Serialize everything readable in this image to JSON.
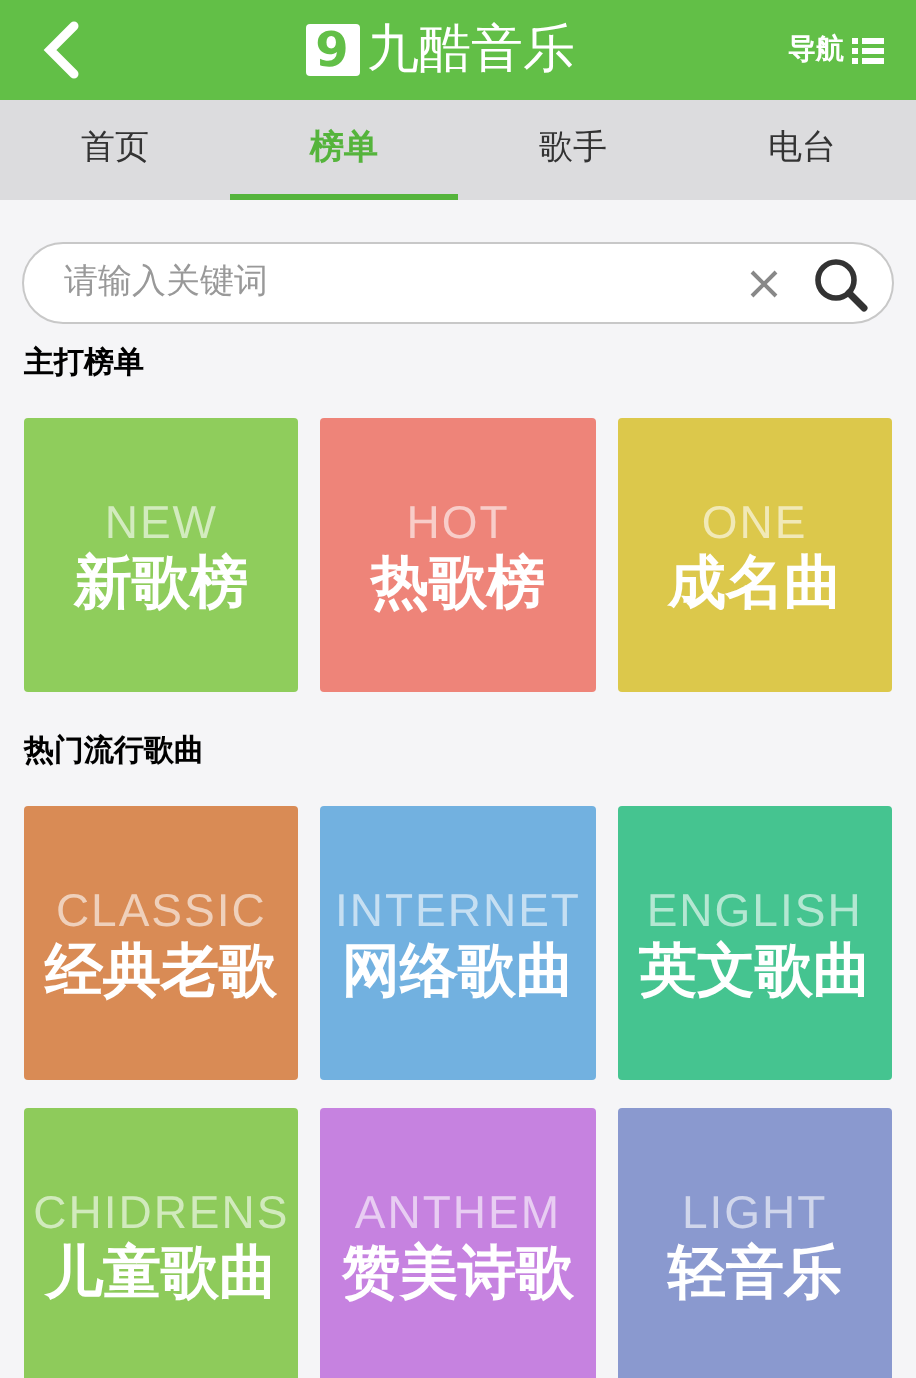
{
  "header": {
    "logo_mark": "9",
    "title": "九酷音乐",
    "nav_label": "导航"
  },
  "tabs": [
    {
      "label": "首页",
      "selected": false
    },
    {
      "label": "榜单",
      "selected": true
    },
    {
      "label": "歌手",
      "selected": false
    },
    {
      "label": "电台",
      "selected": false
    }
  ],
  "search": {
    "placeholder": "请输入关键词"
  },
  "sections": [
    {
      "title": "主打榜单",
      "tiles": [
        {
          "english": "NEW",
          "label": "新歌榜",
          "color": "#8fcd5c"
        },
        {
          "english": "HOT",
          "label": "热歌榜",
          "color": "#ee8479"
        },
        {
          "english": "ONE",
          "label": "成名曲",
          "color": "#dcc84b"
        }
      ]
    },
    {
      "title": "热门流行歌曲",
      "tiles": [
        {
          "english": "CLASSIC",
          "label": "经典老歌",
          "color": "#d98b55"
        },
        {
          "english": "INTERNET",
          "label": "网络歌曲",
          "color": "#72b1e0"
        },
        {
          "english": "ENGLISH",
          "label": "英文歌曲",
          "color": "#45c490"
        },
        {
          "english": "CHIDRENS",
          "label": "儿童歌曲",
          "color": "#8ecb5b"
        },
        {
          "english": "ANTHEM",
          "label": "赞美诗歌",
          "color": "#c682e0"
        },
        {
          "english": "LIGHT",
          "label": "轻音乐",
          "color": "#8a99cf"
        }
      ]
    }
  ]
}
